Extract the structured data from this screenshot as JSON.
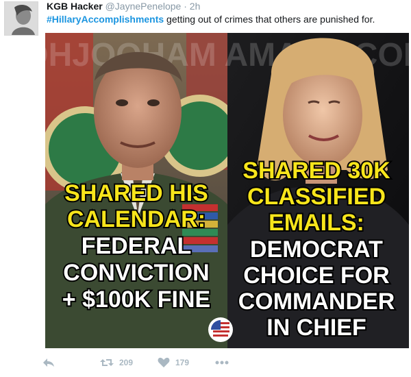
{
  "tweet": {
    "display_name": "KGB Hacker",
    "handle": "@JaynePenelope",
    "separator": "·",
    "time": "2h",
    "hashtag": "#HillaryAccomplishments",
    "text": " getting out of crimes that others are punished for."
  },
  "media": {
    "watermark": "OHJOOHAM AMADE.COM",
    "left_headline": [
      "SHARED HIS",
      "CALENDAR:"
    ],
    "left_body": [
      "FEDERAL",
      "CONVICTION",
      "+ $100K FINE"
    ],
    "right_headline": [
      "SHARED 30K",
      "CLASSIFIED",
      "EMAILS:"
    ],
    "right_body": [
      "DEMOCRAT",
      "CHOICE FOR",
      "COMMANDER",
      "IN CHIEF"
    ],
    "headline_color": "#f7e51b",
    "body_color": "#ffffff"
  },
  "actions": {
    "retweet_count": "209",
    "like_count": "179",
    "icon_color": "#aab8c2"
  }
}
